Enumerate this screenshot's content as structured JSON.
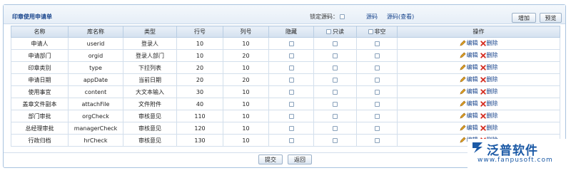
{
  "header": {
    "title": "印章使用申请单",
    "lock_label": "锁定源码：",
    "source_link": "源码",
    "source_view_link": "源码(查看)",
    "add_button": "增加",
    "preview_button": "预览"
  },
  "table": {
    "columns": [
      "名称",
      "库名称",
      "类型",
      "行号",
      "列号",
      "隐藏",
      "只读",
      "非空",
      "操作"
    ],
    "edit_label": "编辑",
    "delete_label": "删除",
    "rows": [
      {
        "name": "申请人",
        "field": "userid",
        "type": "登录人",
        "row": "10",
        "col": "10"
      },
      {
        "name": "申请部门",
        "field": "orgid",
        "type": "登录人部门",
        "row": "10",
        "col": "20"
      },
      {
        "name": "印章类别",
        "field": "type",
        "type": "下拉列表",
        "row": "20",
        "col": "10"
      },
      {
        "name": "申请日期",
        "field": "appDate",
        "type": "当前日期",
        "row": "20",
        "col": "20"
      },
      {
        "name": "使用事宜",
        "field": "content",
        "type": "大文本输入",
        "row": "30",
        "col": "10"
      },
      {
        "name": "盖章文件副本",
        "field": "attachFile",
        "type": "文件附件",
        "row": "40",
        "col": "10"
      },
      {
        "name": "部门审批",
        "field": "orgCheck",
        "type": "审核意见",
        "row": "110",
        "col": "10"
      },
      {
        "name": "总经理审批",
        "field": "managerCheck",
        "type": "审核意见",
        "row": "120",
        "col": "10"
      },
      {
        "name": "行政归档",
        "field": "hrCheck",
        "type": "审核意见",
        "row": "130",
        "col": "10"
      }
    ]
  },
  "footer": {
    "submit_button": "提交",
    "back_button": "返回"
  },
  "watermark": {
    "brand": "泛普软件",
    "url": "www.fanpusoft.com"
  },
  "colors": {
    "accent": "#15428b",
    "border": "#a9c3df",
    "header_bg": "#d4e1ef",
    "delete": "#d32a1e",
    "edit": "#e0a020"
  }
}
